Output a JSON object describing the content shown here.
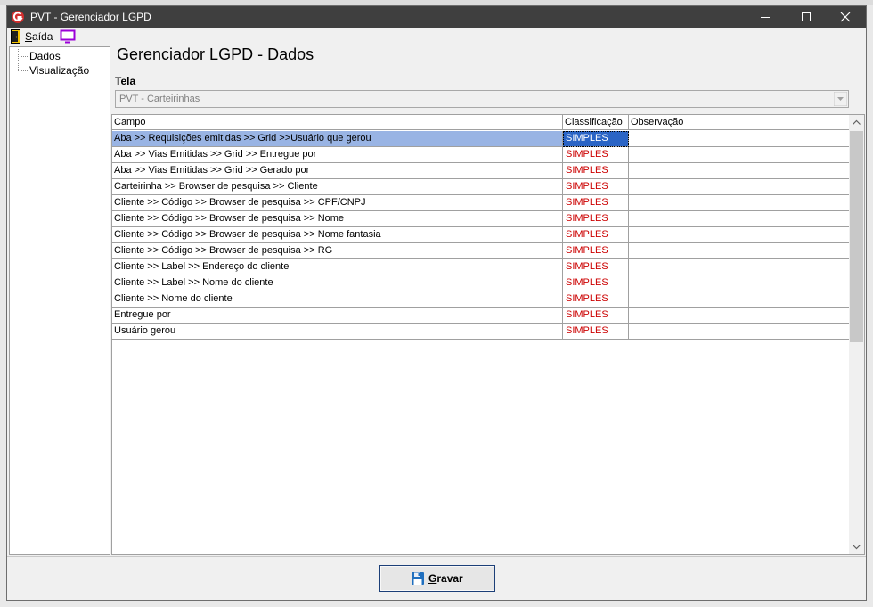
{
  "window": {
    "title": "PVT - Gerenciador LGPD"
  },
  "menu": {
    "exit_label": "Saída"
  },
  "tree": {
    "items": [
      {
        "label": "Dados"
      },
      {
        "label": "Visualização"
      }
    ]
  },
  "main": {
    "title": "Gerenciador LGPD - Dados",
    "tela_label": "Tela",
    "tela_value": "PVT - Carteirinhas"
  },
  "grid": {
    "columns": [
      "Campo",
      "Classificação",
      "Observação"
    ],
    "rows": [
      {
        "campo": "Aba >> Requisições emitidas  >> Grid >>Usuário que gerou",
        "classificacao": "SIMPLES",
        "observacao": ""
      },
      {
        "campo": "Aba >> Vias Emitidas >> Grid >> Entregue por",
        "classificacao": "SIMPLES",
        "observacao": ""
      },
      {
        "campo": "Aba >> Vias Emitidas >> Grid >> Gerado por",
        "classificacao": "SIMPLES",
        "observacao": ""
      },
      {
        "campo": "Carteirinha >> Browser de pesquisa >> Cliente",
        "classificacao": "SIMPLES",
        "observacao": ""
      },
      {
        "campo": "Cliente >> Código >> Browser de pesquisa >> CPF/CNPJ",
        "classificacao": "SIMPLES",
        "observacao": ""
      },
      {
        "campo": "Cliente >> Código >> Browser de pesquisa >> Nome",
        "classificacao": "SIMPLES",
        "observacao": ""
      },
      {
        "campo": "Cliente >> Código >> Browser de pesquisa >> Nome fantasia",
        "classificacao": "SIMPLES",
        "observacao": ""
      },
      {
        "campo": "Cliente >> Código >> Browser de pesquisa >> RG",
        "classificacao": "SIMPLES",
        "observacao": ""
      },
      {
        "campo": "Cliente >> Label >> Endereço do cliente",
        "classificacao": "SIMPLES",
        "observacao": ""
      },
      {
        "campo": "Cliente >> Label >> Nome do cliente",
        "classificacao": "SIMPLES",
        "observacao": ""
      },
      {
        "campo": "Cliente >> Nome do cliente",
        "classificacao": "SIMPLES",
        "observacao": ""
      },
      {
        "campo": "Entregue por",
        "classificacao": "SIMPLES",
        "observacao": ""
      },
      {
        "campo": "Usuário gerou",
        "classificacao": "SIMPLES",
        "observacao": ""
      }
    ],
    "selected_row": 0
  },
  "footer": {
    "save_label": "Gravar"
  },
  "icons": {
    "app": "app-logo-icon",
    "exit": "exit-door-icon",
    "monitor": "monitor-icon",
    "save": "floppy-disk-icon"
  },
  "colors": {
    "titlebar": "#3f3f3f",
    "selected_row": "#99b4e4",
    "selected_cell": "#2a64c5",
    "classification_text": "#cc0000",
    "monitor_icon": "#9b00d8"
  }
}
